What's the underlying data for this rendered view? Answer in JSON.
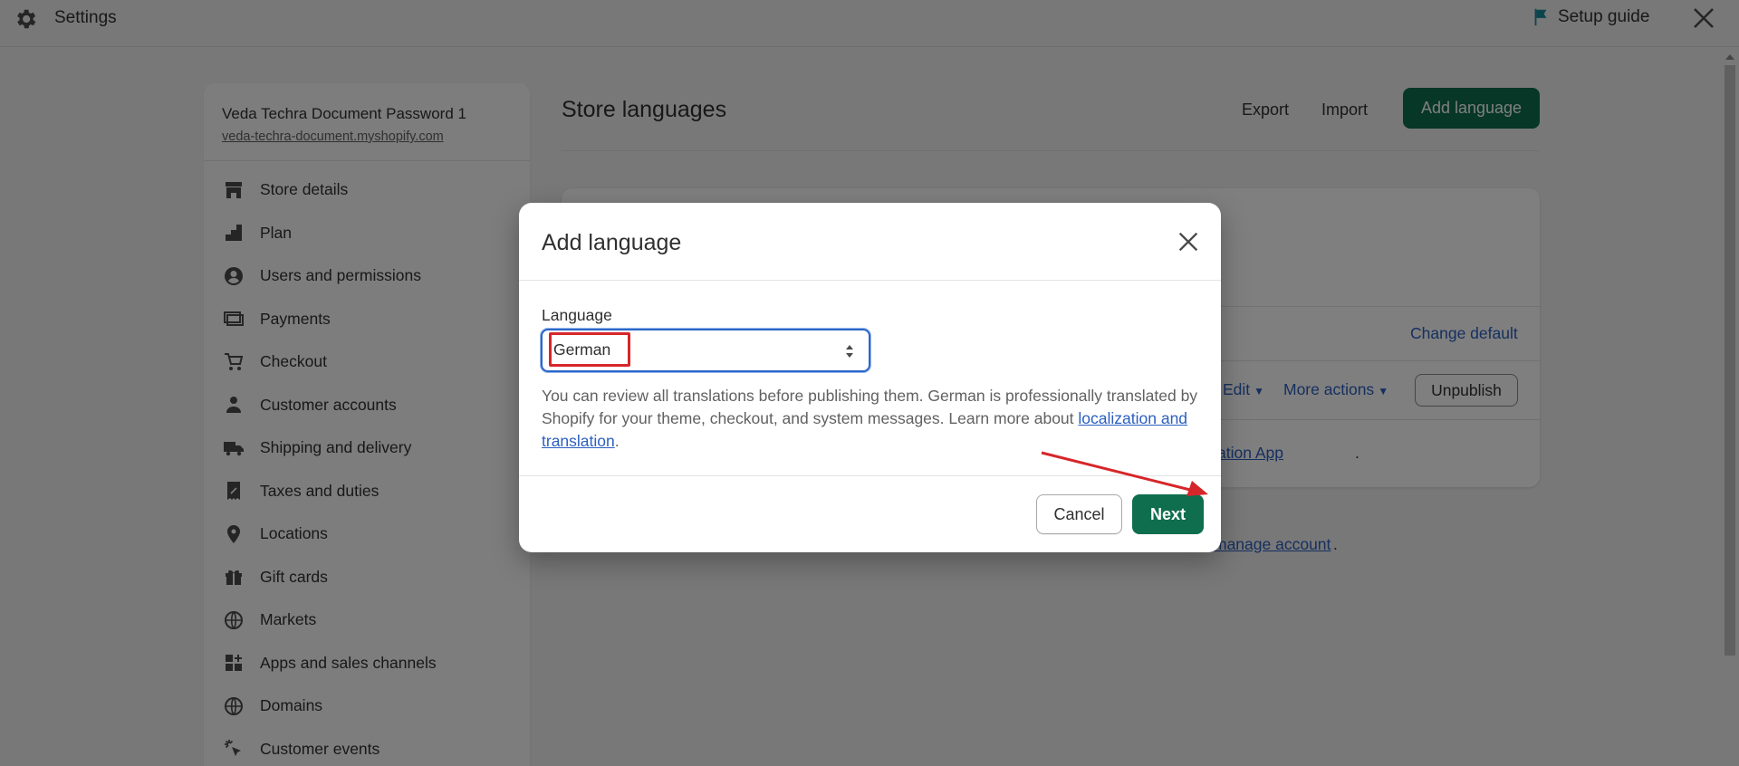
{
  "topbar": {
    "title": "Settings",
    "setup_guide": "Setup guide"
  },
  "sidebar": {
    "store_name": "Veda Techra Document Password 1",
    "store_url": "veda-techra-document.myshopify.com",
    "items": [
      {
        "label": "Store details",
        "icon": "store-icon"
      },
      {
        "label": "Plan",
        "icon": "plan-icon"
      },
      {
        "label": "Users and permissions",
        "icon": "user-circle-icon"
      },
      {
        "label": "Payments",
        "icon": "payments-icon"
      },
      {
        "label": "Checkout",
        "icon": "cart-icon"
      },
      {
        "label": "Customer accounts",
        "icon": "person-icon"
      },
      {
        "label": "Shipping and delivery",
        "icon": "truck-icon"
      },
      {
        "label": "Taxes and duties",
        "icon": "receipt-icon"
      },
      {
        "label": "Locations",
        "icon": "location-pin-icon"
      },
      {
        "label": "Gift cards",
        "icon": "gift-icon"
      },
      {
        "label": "Markets",
        "icon": "globe-icon"
      },
      {
        "label": "Apps and sales channels",
        "icon": "apps-icon"
      },
      {
        "label": "Domains",
        "icon": "domains-globe-icon"
      },
      {
        "label": "Customer events",
        "icon": "sparkle-cursor-icon"
      }
    ]
  },
  "main": {
    "title": "Store languages",
    "export": "Export",
    "import": "Import",
    "add_language": "Add language",
    "change_default": "Change default",
    "edit": "Edit",
    "more_actions": "More actions",
    "unpublish": "Unpublish",
    "geo_link": "n Geolocation App",
    "geo_tail": ".",
    "manage_account": "manage account",
    "manage_tail": "."
  },
  "modal": {
    "title": "Add language",
    "language_label": "Language",
    "selected_language": "German",
    "help_text": "You can review all translations before publishing them. German is professionally translated by Shopify for your theme, checkout, and system messages. Learn more about ",
    "help_link": "localization and translation",
    "help_tail": ".",
    "cancel": "Cancel",
    "next": "Next"
  },
  "colors": {
    "primary_button": "#0f6e4e",
    "link": "#2b5fbf",
    "focus_ring": "#2b67c9",
    "annotation_red": "#d6262a"
  }
}
